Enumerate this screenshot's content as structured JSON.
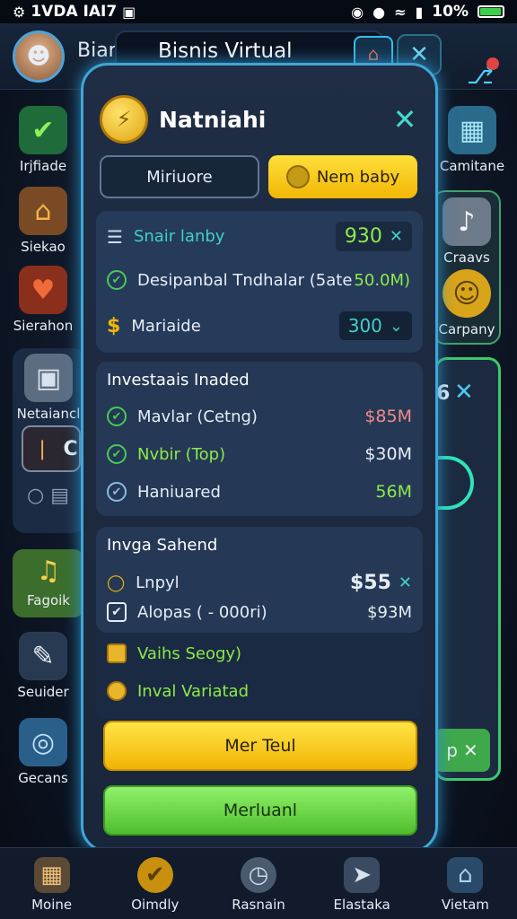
{
  "status_bar": {
    "left": "1VDA IAI7",
    "battery": "10%"
  },
  "header": {
    "name": "Bian",
    "title": "Bisnis Virtual"
  },
  "left_menu": [
    {
      "label": "Irjfiade"
    },
    {
      "label": "Siekao"
    },
    {
      "label": "Sierahon"
    },
    {
      "label": "Netaiancl"
    },
    {
      "label": "C"
    },
    {
      "label": "Fagoik"
    },
    {
      "label": "Seuider"
    },
    {
      "label": "Gecans"
    }
  ],
  "right_menu": [
    {
      "label": "Camitane"
    },
    {
      "label": "Craavs"
    },
    {
      "label": "Carpany"
    },
    {
      "label": "6"
    },
    {
      "label": "p"
    }
  ],
  "modal": {
    "title": "Natniahi",
    "tabs": [
      "Miriuore",
      "Nem baby"
    ],
    "section1": {
      "rows": [
        {
          "label": "Snair lanby",
          "value": "930"
        },
        {
          "label": "Desipanbal Tndhalar (5ate",
          "value": "50.0M)"
        },
        {
          "label": "Mariaide",
          "value": "300"
        }
      ]
    },
    "section2": {
      "title": "Investaais Inaded",
      "rows": [
        {
          "label": "Mavlar (Cetng)",
          "value": "$85M"
        },
        {
          "label": "Nvbir (Top)",
          "value": "$30M"
        },
        {
          "label": "Haniuared",
          "value": "56M"
        }
      ]
    },
    "section3": {
      "title": "Invga Sahend",
      "rows": [
        {
          "label": "Lnpyl",
          "value": "$55"
        },
        {
          "label": "Alopas ( - 000ri)",
          "value": "$93M"
        }
      ]
    },
    "section4": {
      "rows": [
        {
          "label": "Vaihs Seogy)"
        },
        {
          "label": "Inval Variatad"
        }
      ]
    },
    "buttons": {
      "primary": "Mer Teul",
      "secondary": "Merluanl"
    }
  },
  "bottom_nav": [
    {
      "label": "Moine"
    },
    {
      "label": "Oimdly"
    },
    {
      "label": "Rasnain"
    },
    {
      "label": "Elastaka"
    },
    {
      "label": "Vietam"
    }
  ],
  "colors": {
    "accent_yellow": "#f2b706",
    "accent_green": "#4fbd2e",
    "frame": "#3ea7d6"
  }
}
